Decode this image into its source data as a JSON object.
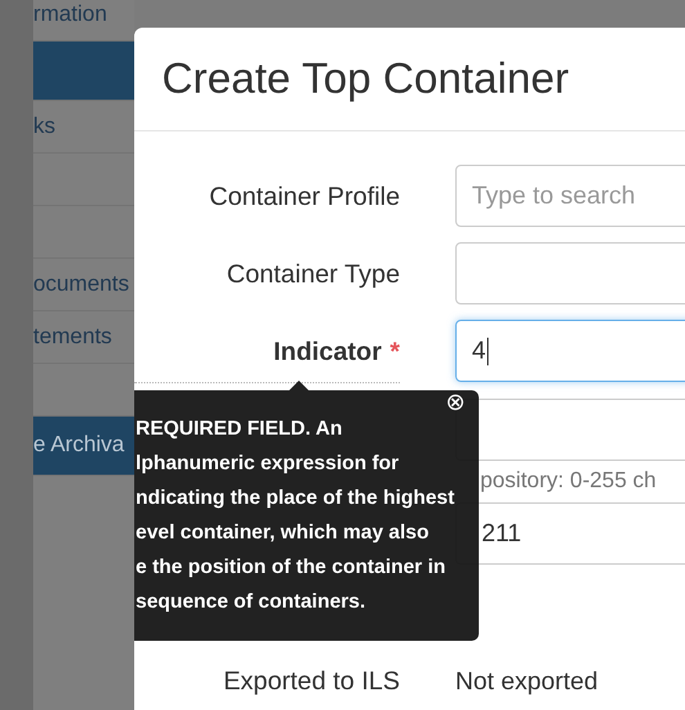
{
  "sidebar": {
    "items": [
      {
        "label": "rmation",
        "selected": false
      },
      {
        "selected": true
      },
      {
        "label": "ks",
        "selected": false
      },
      {
        "selected": false
      },
      {
        "selected": false
      },
      {
        "label": "ocuments",
        "selected": false
      },
      {
        "label": "tements",
        "selected": false
      },
      {
        "selected": false
      },
      {
        "label": "e Archiva",
        "selected": true
      }
    ]
  },
  "modal": {
    "title": "Create Top Container",
    "rows": [
      {
        "kind": "field",
        "label": "Container Profile",
        "required": false,
        "focused": false,
        "placeholder": "Type to search"
      },
      {
        "kind": "field",
        "label": "Container Type",
        "required": false,
        "focused": false
      },
      {
        "kind": "field",
        "label": "Indicator",
        "required": true,
        "required_mark": "*",
        "focused": true,
        "value": "4"
      },
      {
        "kind": "field",
        "focused": false,
        "hint": "pository: 0-255 ch"
      },
      {
        "kind": "field",
        "focused": false,
        "value": "211"
      },
      {
        "kind": "plain",
        "label": "Exported to ILS",
        "required": false,
        "value": "Not exported"
      }
    ],
    "tooltip": {
      "lines": [
        "REQUIRED FIELD. An",
        "lphanumeric expression for",
        "ndicating the place of the highest",
        "evel container, which may also",
        "e the position of the container in",
        "sequence of containers."
      ],
      "close": "⊗"
    }
  }
}
